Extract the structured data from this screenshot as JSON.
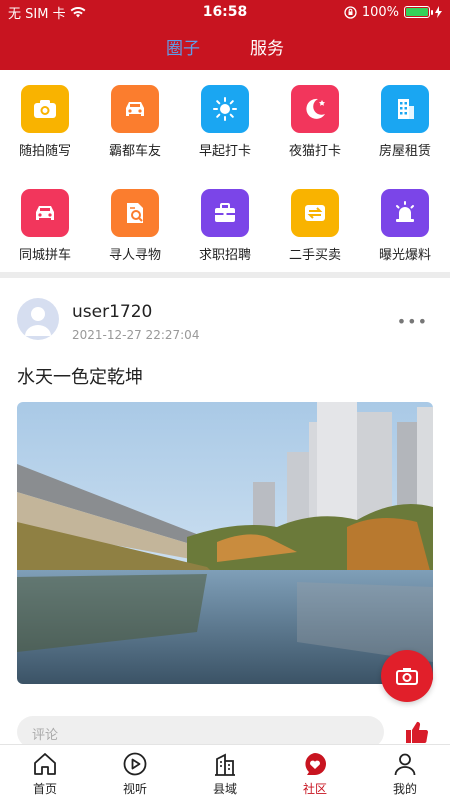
{
  "status_bar": {
    "carrier": "无 SIM 卡",
    "time": "16:58",
    "battery": "100%"
  },
  "top_tabs": [
    {
      "label": "圈子",
      "active": true
    },
    {
      "label": "服务",
      "active": false
    }
  ],
  "categories": [
    {
      "label": "随拍随写",
      "icon": "camera-icon",
      "color": "#f9b300"
    },
    {
      "label": "霸都车友",
      "icon": "car-icon",
      "color": "#fb7d2e"
    },
    {
      "label": "早起打卡",
      "icon": "sun-icon",
      "color": "#1aa6f2"
    },
    {
      "label": "夜猫打卡",
      "icon": "moon-icon",
      "color": "#f2365c"
    },
    {
      "label": "房屋租赁",
      "icon": "building-icon",
      "color": "#1aa6f2"
    },
    {
      "label": "同城拼车",
      "icon": "car-icon",
      "color": "#f2365c"
    },
    {
      "label": "寻人寻物",
      "icon": "search-document-icon",
      "color": "#fb7d2e"
    },
    {
      "label": "求职招聘",
      "icon": "briefcase-icon",
      "color": "#7b45e8"
    },
    {
      "label": "二手买卖",
      "icon": "exchange-icon",
      "color": "#f9b300"
    },
    {
      "label": "曝光爆料",
      "icon": "siren-icon",
      "color": "#7b45e8"
    }
  ],
  "post": {
    "username": "user1720",
    "time": "2021-12-27 22:27:04",
    "more": "•••",
    "content": "水天一色定乾坤",
    "comment_placeholder": "评论"
  },
  "bottom_tabs": [
    {
      "label": "首页",
      "icon": "home-icon",
      "active": false
    },
    {
      "label": "视听",
      "icon": "play-icon",
      "active": false
    },
    {
      "label": "县域",
      "icon": "building-icon",
      "active": false
    },
    {
      "label": "社区",
      "icon": "heart-chat-icon",
      "active": true
    },
    {
      "label": "我的",
      "icon": "person-icon",
      "active": false
    }
  ],
  "colors": {
    "brand": "#c81420",
    "accent_tab": "#5f9ee9",
    "fab": "#e11f2a"
  }
}
